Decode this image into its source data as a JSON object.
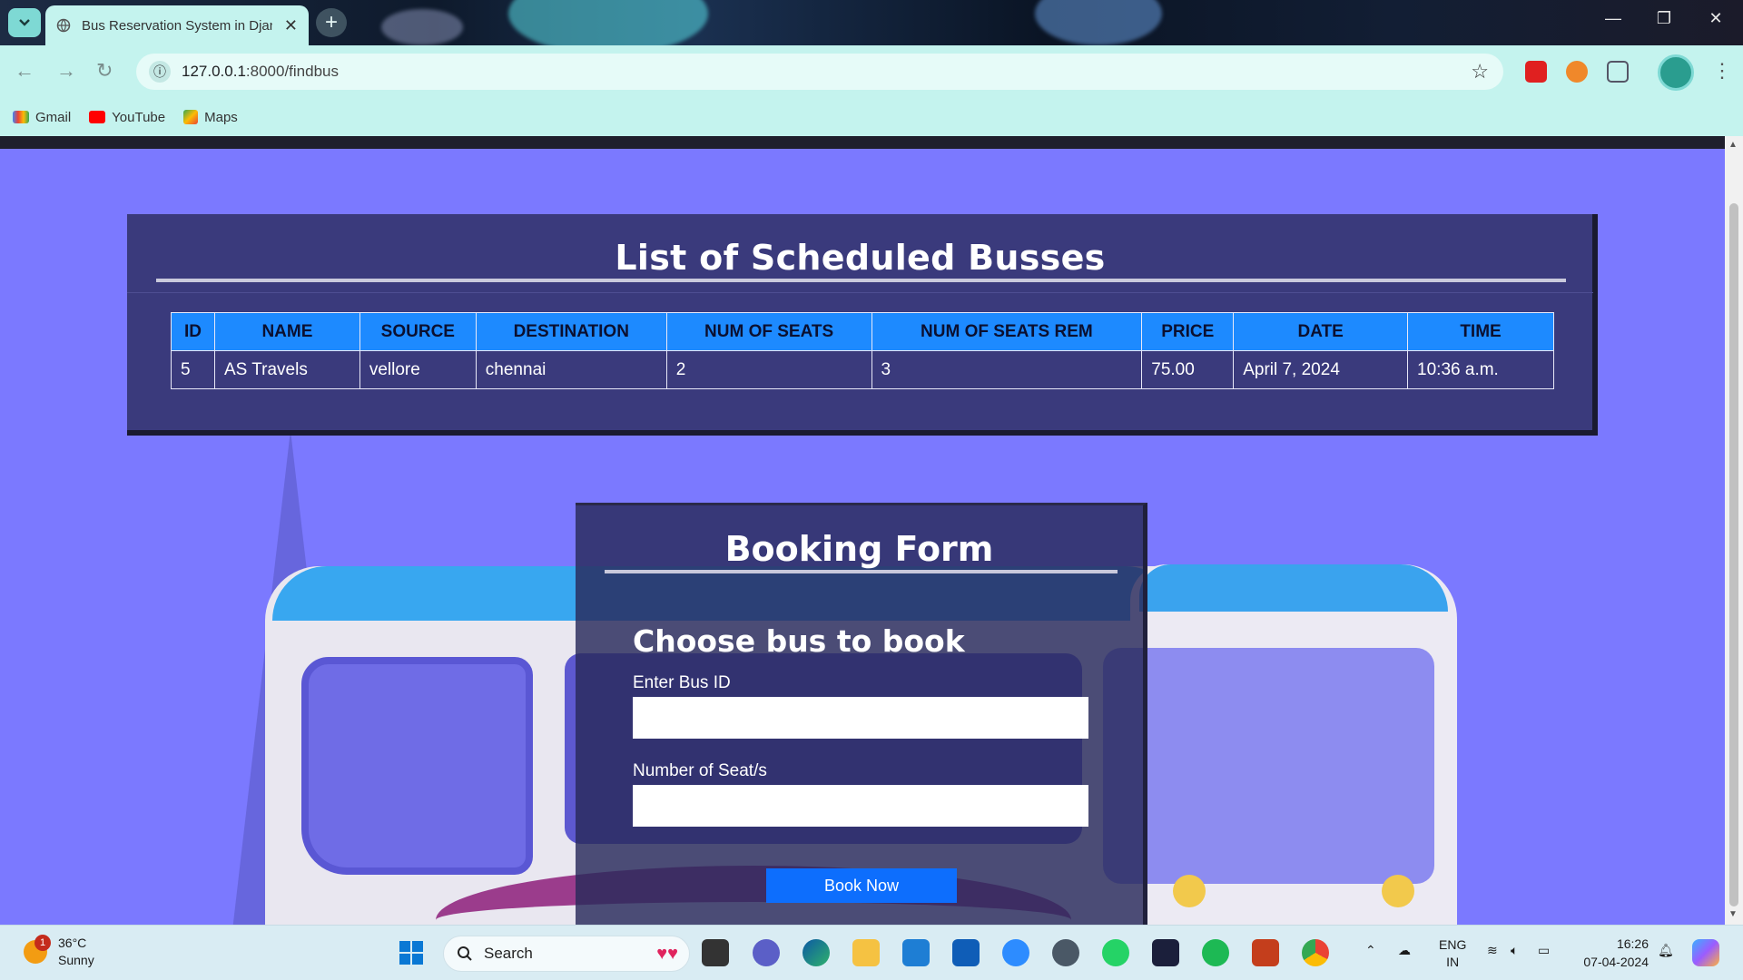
{
  "browser": {
    "tab_title": "Bus Reservation System in Djan",
    "url_host": "127.0.0.1",
    "url_path": ":8000/findbus",
    "bookmarks": [
      {
        "label": "Gmail",
        "icon": "gmail-icon",
        "color": "#ea4335"
      },
      {
        "label": "YouTube",
        "icon": "youtube-icon",
        "color": "#ff0000"
      },
      {
        "label": "Maps",
        "icon": "maps-icon",
        "color": "#34a853"
      }
    ]
  },
  "bus_list": {
    "title": "List of Scheduled Busses",
    "columns": [
      "ID",
      "NAME",
      "SOURCE",
      "DESTINATION",
      "NUM OF SEATS",
      "NUM OF SEATS REM",
      "PRICE",
      "DATE",
      "TIME"
    ],
    "rows": [
      [
        "5",
        "AS Travels",
        "vellore",
        "chennai",
        "2",
        "3",
        "75.00",
        "April 7, 2024",
        "10:36 a.m."
      ]
    ]
  },
  "booking": {
    "title": "Booking Form",
    "subtitle": "Choose bus to book",
    "bus_id_label": "Enter Bus ID",
    "bus_id_value": "",
    "seats_label": "Number of Seat/s",
    "seats_value": "",
    "submit_label": "Book Now"
  },
  "taskbar": {
    "weather_temp": "36°C",
    "weather_desc": "Sunny",
    "weather_badge": "1",
    "search_placeholder": "Search",
    "lang_top": "ENG",
    "lang_bottom": "IN",
    "time": "16:26",
    "date": "07-04-2024"
  },
  "colors": {
    "page_bg": "#7b79ff",
    "card_bg": "#3a3a7c",
    "table_header": "#1d8aff",
    "button": "#0d6efd"
  }
}
